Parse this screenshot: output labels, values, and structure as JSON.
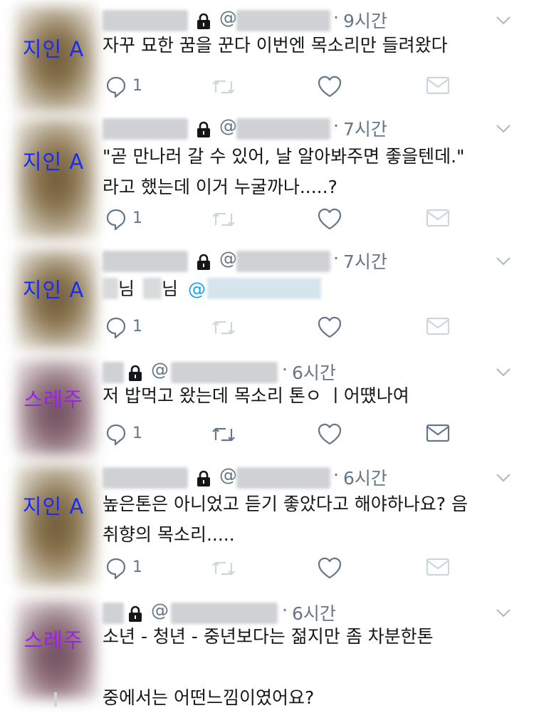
{
  "tweets": [
    {
      "annotation": "지인 A",
      "annotation_color": "#1a2cf0",
      "avatar_tone": "brown",
      "at": "@",
      "time_sep": "·",
      "time": "9시간",
      "lines": [
        "자꾸 묘한 꿈을 꾼다 이번엔 목소리만 들려왔다"
      ],
      "reply_count": "1"
    },
    {
      "annotation": "지인 A",
      "annotation_color": "#1a2cf0",
      "avatar_tone": "brown",
      "at": "@",
      "time_sep": "·",
      "time": "7시간",
      "lines": [
        "\"곧 만나러 갈 수 있어, 날 알아봐주면 좋을텐데.\"",
        "라고 했는데 이거 누굴까나.....?"
      ],
      "reply_count": "1"
    },
    {
      "annotation": "지인 A",
      "annotation_color": "#1a2cf0",
      "avatar_tone": "brown",
      "at": "@",
      "time_sep": "·",
      "time": "7시간",
      "word_a": "님",
      "word_b": "님",
      "mention_at": "@",
      "reply_count": "1"
    },
    {
      "annotation": "스레주",
      "annotation_color": "#9a22e6",
      "avatar_tone": "purple",
      "at": "@",
      "time_sep": "·",
      "time": "6시간",
      "lines": [
        "저 밥먹고 왔는데 목소리 톤ㅇ  ㅣ어떘나여"
      ],
      "reply_count": "1"
    },
    {
      "annotation": "지인 A",
      "annotation_color": "#1a2cf0",
      "avatar_tone": "brown",
      "at": "@",
      "time_sep": "·",
      "time": "6시간",
      "lines": [
        "높은톤은 아니었고 듣기 좋았다고 해야하나요? 음",
        "취향의 목소리....."
      ],
      "reply_count": "1"
    },
    {
      "annotation": "스레주",
      "annotation_color": "#9a22e6",
      "avatar_tone": "purple",
      "at": "@",
      "time_sep": "·",
      "time": "6시간",
      "lines": [
        "소년 - 청년 - 중년보다는 젊지만 좀 차분한톤",
        "",
        "중에서는 어떤느낌이였어요?"
      ]
    }
  ],
  "icons": {
    "reply": "reply-icon",
    "retweet": "retweet-icon",
    "like": "heart-icon",
    "dm": "envelope-icon",
    "lock": "lock-icon",
    "caret": "chevron-down-icon"
  }
}
